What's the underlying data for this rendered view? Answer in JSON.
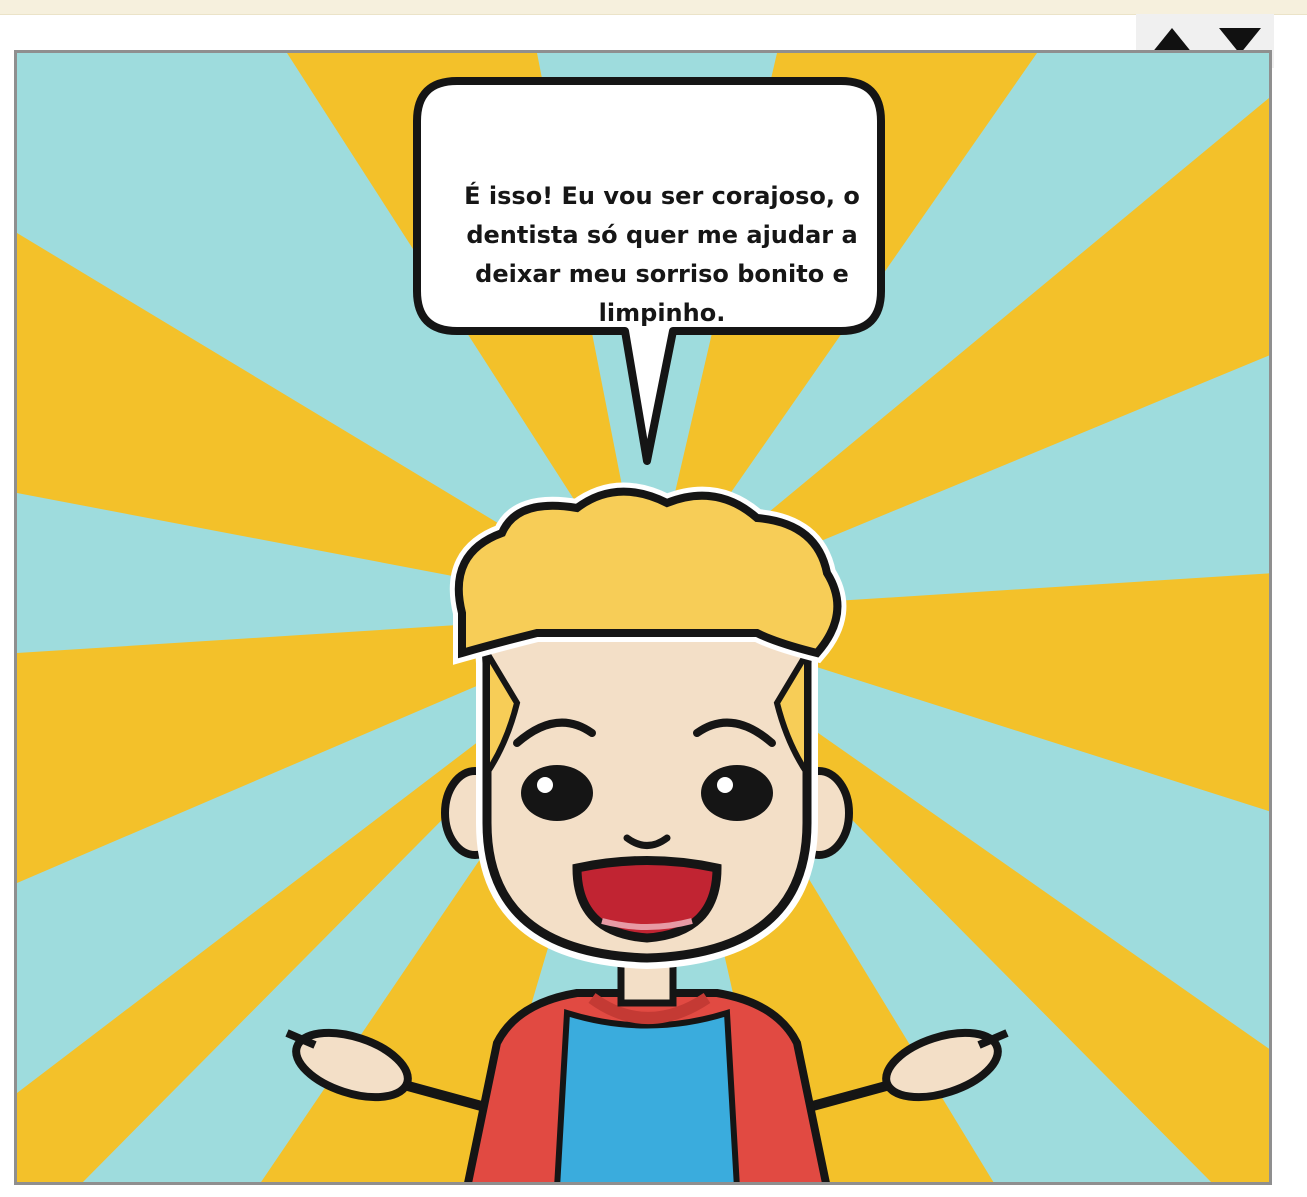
{
  "nav": {
    "up_icon": "triangle-up-icon",
    "down_icon": "triangle-down-icon"
  },
  "comic": {
    "speech_text": "É isso! Eu vou ser corajoso, o dentista só quer me ajudar a deixar meu sorriso bonito e limpinho.",
    "colors": {
      "ray_blue": "#9edcdd",
      "ray_yellow": "#f3c12a",
      "hair": "#f7cd57",
      "skin": "#f3dfc7",
      "shirt_blue": "#3aacdd",
      "sleeve_red": "#e14a42",
      "mouth_red": "#c12432"
    }
  }
}
